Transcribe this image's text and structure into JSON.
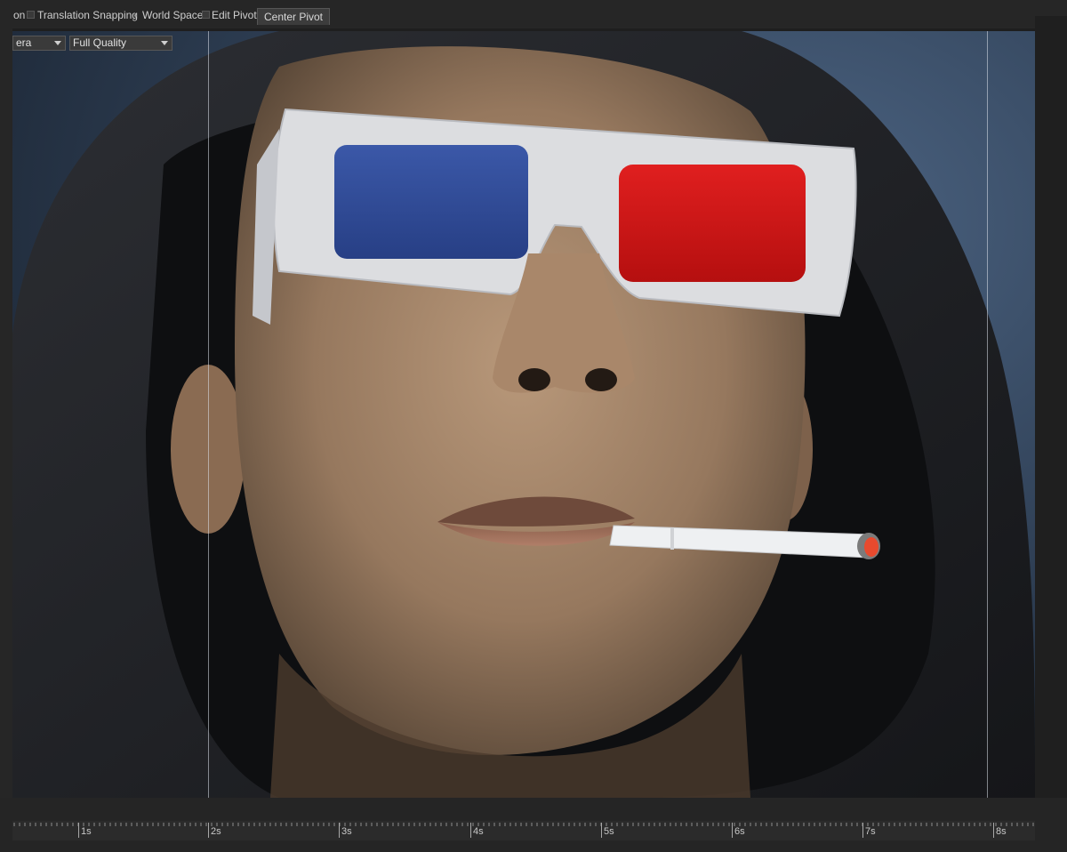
{
  "toolbar": {
    "items": [
      "on",
      "Translation Snapping",
      "World Space",
      "Edit Pivot"
    ],
    "center_pivot_label": "Center Pivot"
  },
  "viewport": {
    "camera_dropdown": "era",
    "quality_dropdown": "Full Quality",
    "render_subject": "3d-rendered-man-in-hood-with-anaglyph-glasses-and-cigarette"
  },
  "timeline": {
    "ticks": [
      "1s",
      "2s",
      "3s",
      "4s",
      "5s",
      "6s",
      "7s",
      "8s"
    ]
  },
  "colors": {
    "background": "#2b3a4c",
    "ui_dark": "#262626",
    "lens_left": "#2f4f9e",
    "lens_right": "#d41818"
  }
}
